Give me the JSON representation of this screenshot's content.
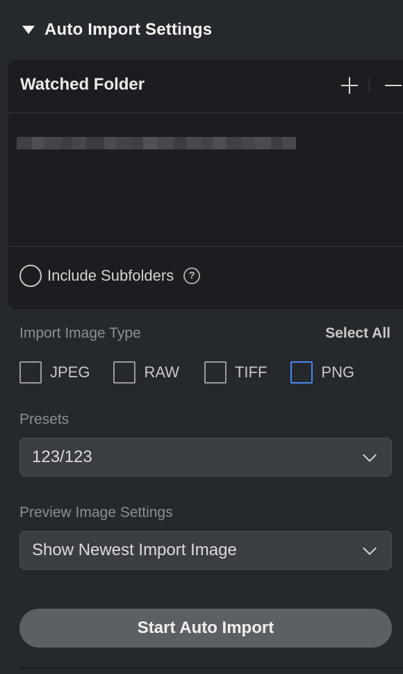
{
  "section": {
    "title": "Auto Import Settings"
  },
  "watched_folder": {
    "title": "Watched Folder",
    "path_redacted_segments": [
      "#3f4044",
      "#4d4e52",
      "#444549",
      "#3d3e42",
      "#46474b",
      "#3a3b3f",
      "#4a4b4f",
      "#434448",
      "#3e3f43",
      "#505155",
      "#47484c",
      "#3c3d41",
      "#49494d",
      "#424347",
      "#4e4f53",
      "#3f4044",
      "#45464a",
      "#4b4c50",
      "#3d3e42",
      "#48494d"
    ]
  },
  "include_subfolders": {
    "label": "Include Subfolders",
    "help_glyph": "?"
  },
  "import_image_type": {
    "label": "Import Image Type",
    "select_all_label": "Select All",
    "types": [
      {
        "label": "JPEG"
      },
      {
        "label": "RAW"
      },
      {
        "label": "TIFF"
      },
      {
        "label": "PNG"
      }
    ]
  },
  "presets": {
    "label": "Presets",
    "value": "123/123"
  },
  "preview_image_settings": {
    "label": "Preview Image Settings",
    "value": "Show Newest Import Image"
  },
  "start_button": {
    "label": "Start Auto Import"
  },
  "colors": {
    "background": "#25282c",
    "panel": "#1c1d20",
    "focus_blue": "#4b86f0",
    "button": "#5c6064"
  }
}
